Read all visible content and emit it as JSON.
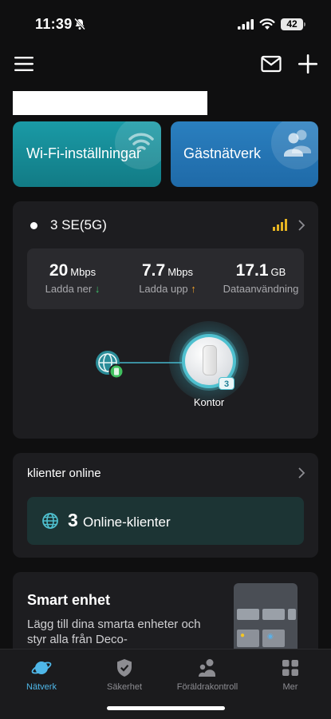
{
  "status_bar": {
    "time": "11:39",
    "battery": "42",
    "icons": [
      "bell-off-icon",
      "cellular-signal-icon",
      "wifi-icon",
      "battery-icon"
    ]
  },
  "header": {
    "icons": [
      "menu-icon",
      "mail-icon",
      "plus-icon"
    ]
  },
  "feature_cards": {
    "wifi_settings": "Wi-Fi-inställningar",
    "guest_network": "Gästnätverk"
  },
  "network": {
    "name": "3 SE(5G)",
    "stats": {
      "download_value": "20",
      "download_unit": "Mbps",
      "download_label": "Ladda ner",
      "upload_value": "7.7",
      "upload_unit": "Mbps",
      "upload_label": "Ladda upp",
      "data_value": "17.1",
      "data_unit": "GB",
      "data_label": "Dataanvändning"
    },
    "router": {
      "label": "Kontor",
      "badge": "3"
    }
  },
  "clients": {
    "title": "klienter online",
    "count": "3",
    "label": "Online-klienter"
  },
  "smart_device": {
    "title": "Smart enhet",
    "description": "Lägg till dina smarta enheter och styr alla från Deco-"
  },
  "tabs": [
    {
      "label": "Nätverk",
      "icon": "planet-icon",
      "active": true
    },
    {
      "label": "Säkerhet",
      "icon": "shield-icon",
      "active": false
    },
    {
      "label": "Föräldrakontroll",
      "icon": "parents-icon",
      "active": false
    },
    {
      "label": "Mer",
      "icon": "grid-icon",
      "active": false
    }
  ],
  "colors": {
    "background": "#0f0f10",
    "card": "#1d1d20",
    "accent": "#4fb7e8",
    "wifi_card": "#1a9aa6",
    "guest_card": "#2a7fbf",
    "download_arrow": "#3fc46c",
    "upload_arrow": "#f0a02a"
  }
}
